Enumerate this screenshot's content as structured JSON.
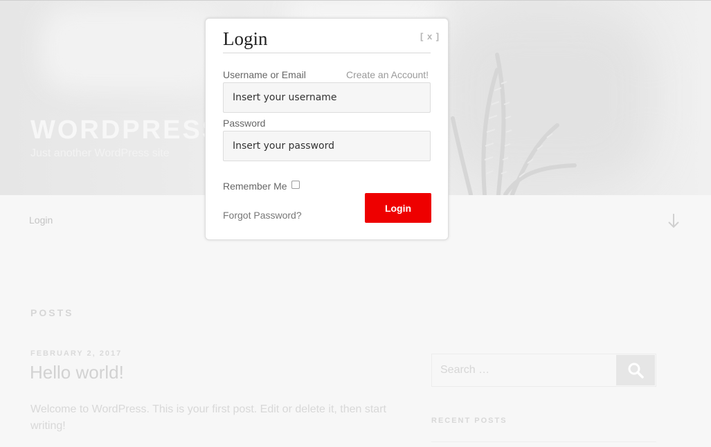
{
  "site": {
    "title": "WORDPRESS",
    "tagline": "Just another WordPress site"
  },
  "nav": {
    "login_label": "Login",
    "scroll_icon": "arrow-down-icon"
  },
  "content": {
    "section_heading": "POSTS",
    "post": {
      "date": "FEBRUARY 2, 2017",
      "title": "Hello world!",
      "excerpt": "Welcome to WordPress. This is your first post. Edit or delete it, then start writing!"
    }
  },
  "sidebar": {
    "search_placeholder": "Search …",
    "search_icon": "search-icon",
    "recent_heading": "RECENT POSTS"
  },
  "modal": {
    "title": "Login",
    "close_label": "[ x ]",
    "username_label": "Username or Email",
    "create_account_link": "Create an Account!",
    "username_value": "Insert your username",
    "password_label": "Password",
    "password_value": "Insert your password",
    "remember_label": "Remember Me",
    "remember_checked": false,
    "forgot_link": "Forgot Password?",
    "login_button": "Login",
    "accent_color": "#ee0000"
  }
}
